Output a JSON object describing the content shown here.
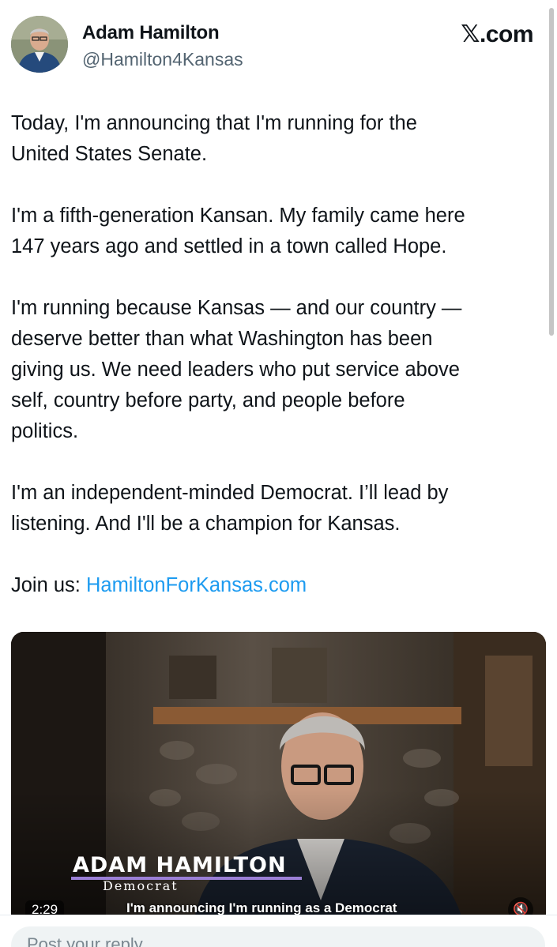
{
  "author": {
    "name": "Adam Hamilton",
    "handle": "@Hamilton4Kansas",
    "avatar_icon": "profile-photo"
  },
  "source": {
    "brand_glyph": "𝕏",
    "brand_suffix": ".com"
  },
  "tweet": {
    "paragraphs": [
      "Today, I'm announcing that I'm running for the\nUnited States Senate.",
      "I'm a fifth-generation Kansan. My family came here\n147 years ago and settled in a town called Hope.",
      "I'm running because Kansas — and our country —\ndeserve better than what Washington has been\ngiving us. We need leaders who put service above\nself, country before party, and people before\npolitics.",
      "I'm an independent-minded Democrat. I’ll lead by\nlistening. And I'll be a champion for Kansas."
    ],
    "join_prefix": "Join us: ",
    "join_link": "HamiltonForKansas.com"
  },
  "video": {
    "lower_third_name": "ADAM HAMILTON",
    "lower_third_party": "Democrat",
    "timestamp": "2:29",
    "caption": "I'm announcing I'm running as a Democrat",
    "mute_icon": "muted-speaker-icon",
    "colors": {
      "accent_rule": "#9b7fd6"
    }
  },
  "reply": {
    "placeholder": "Post your reply"
  },
  "colors": {
    "link": "#1d9bf0",
    "handle": "#536471",
    "text": "#0f1419"
  }
}
